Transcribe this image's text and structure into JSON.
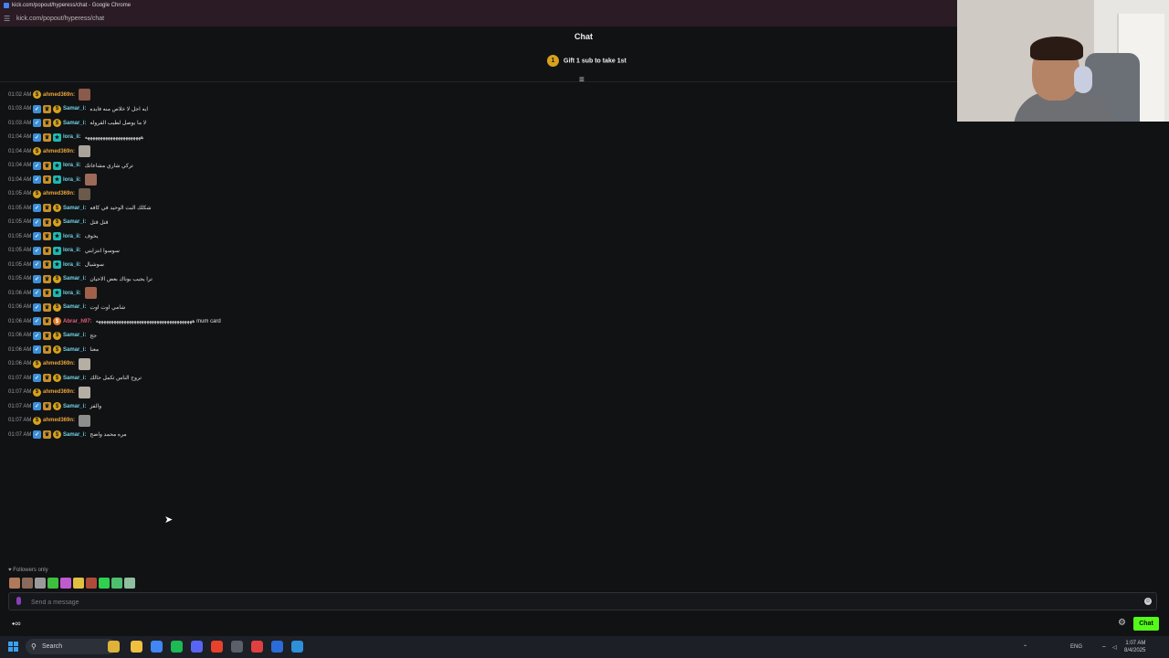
{
  "browser": {
    "title": "kick.com/popout/hyperess/chat - Google Chrome",
    "url": "kick.com/popout/hyperess/chat"
  },
  "chat": {
    "title": "Chat",
    "gift_badge": "1",
    "gift_text": "Gift 1 sub to take 1st",
    "messages": [
      {
        "time": "01:02 AM",
        "user": "ahmed369n:",
        "color": "#e8a33a",
        "badges": [
          "sub"
        ],
        "text": "",
        "emote": "#8a5a4a"
      },
      {
        "time": "01:03 AM",
        "user": "Samar_i:",
        "color": "#6fd3e6",
        "badges": [
          "blue",
          "crown",
          "sub"
        ],
        "text": "ايه اجل لا خلاص منه فايده",
        "emote": ""
      },
      {
        "time": "01:03 AM",
        "user": "Samar_i:",
        "color": "#6fd3e6",
        "badges": [
          "blue",
          "crown",
          "sub"
        ],
        "text": "لا ما يوصل لطيب القروله",
        "emote": ""
      },
      {
        "time": "01:04 AM",
        "user": "lora_ii:",
        "color": "#6fd3e6",
        "badges": [
          "blue",
          "crown",
          "teal"
        ],
        "text": "ههههههههههههههههههههههه",
        "emote": ""
      },
      {
        "time": "01:04 AM",
        "user": "ahmed369n:",
        "color": "#e8a33a",
        "badges": [
          "sub"
        ],
        "text": "",
        "emote": "#a9a39a"
      },
      {
        "time": "01:04 AM",
        "user": "lora_ii:",
        "color": "#6fd3e6",
        "badges": [
          "blue",
          "crown",
          "teal"
        ],
        "text": "تركي شاري مشاعاتك",
        "emote": ""
      },
      {
        "time": "01:04 AM",
        "user": "lora_ii:",
        "color": "#6fd3e6",
        "badges": [
          "blue",
          "crown",
          "teal"
        ],
        "text": "",
        "emote": "#9c6a58"
      },
      {
        "time": "01:05 AM",
        "user": "ahmed369n:",
        "color": "#e8a33a",
        "badges": [
          "sub"
        ],
        "text": "",
        "emote": "#6b5a4a"
      },
      {
        "time": "01:05 AM",
        "user": "Samar_i:",
        "color": "#6fd3e6",
        "badges": [
          "blue",
          "crown",
          "sub"
        ],
        "text": "شكلك البث الوحيد في كافه",
        "emote": ""
      },
      {
        "time": "01:05 AM",
        "user": "Samar_i:",
        "color": "#6fd3e6",
        "badges": [
          "blue",
          "crown",
          "sub"
        ],
        "text": "قتل قتل",
        "emote": ""
      },
      {
        "time": "01:05 AM",
        "user": "lora_ii:",
        "color": "#6fd3e6",
        "badges": [
          "blue",
          "crown",
          "teal"
        ],
        "text": "يخوف",
        "emote": ""
      },
      {
        "time": "01:05 AM",
        "user": "lora_ii:",
        "color": "#6fd3e6",
        "badges": [
          "blue",
          "crown",
          "teal"
        ],
        "text": "سوسوا انتزابتي",
        "emote": ""
      },
      {
        "time": "01:05 AM",
        "user": "lora_ii:",
        "color": "#6fd3e6",
        "badges": [
          "blue",
          "crown",
          "teal"
        ],
        "text": "سوشيال",
        "emote": ""
      },
      {
        "time": "01:05 AM",
        "user": "Samar_i:",
        "color": "#6fd3e6",
        "badges": [
          "blue",
          "crown",
          "sub"
        ],
        "text": "ترا يجيب بوناك بعض الاحيان",
        "emote": ""
      },
      {
        "time": "01:06 AM",
        "user": "lora_ii:",
        "color": "#6fd3e6",
        "badges": [
          "blue",
          "crown",
          "teal"
        ],
        "text": "",
        "emote": "#a0604a"
      },
      {
        "time": "01:06 AM",
        "user": "Samar_i:",
        "color": "#6fd3e6",
        "badges": [
          "blue",
          "crown",
          "sub"
        ],
        "text": "شامي اوت اوت",
        "emote": ""
      },
      {
        "time": "01:06 AM",
        "user": "Abrar_h97:",
        "color": "#e0607a",
        "badges": [
          "blue",
          "crown",
          "orange"
        ],
        "text": "ههههههههههههههههههههههههههههههههههههههه mum card",
        "emote": ""
      },
      {
        "time": "01:06 AM",
        "user": "Samar_i:",
        "color": "#6fd3e6",
        "badges": [
          "blue",
          "crown",
          "sub"
        ],
        "text": "جج",
        "emote": ""
      },
      {
        "time": "01:06 AM",
        "user": "Samar_i:",
        "color": "#6fd3e6",
        "badges": [
          "blue",
          "crown",
          "sub"
        ],
        "text": "معنا",
        "emote": ""
      },
      {
        "time": "01:06 AM",
        "user": "ahmed369n:",
        "color": "#e8a33a",
        "badges": [
          "sub"
        ],
        "text": "",
        "emote": "#b5aea3"
      },
      {
        "time": "01:07 AM",
        "user": "Samar_i:",
        "color": "#6fd3e6",
        "badges": [
          "blue",
          "crown",
          "sub"
        ],
        "text": "تروح الناس تكمل حالك",
        "emote": ""
      },
      {
        "time": "01:07 AM",
        "user": "ahmed369n:",
        "color": "#e8a33a",
        "badges": [
          "sub"
        ],
        "text": "",
        "emote": "#b5aea3"
      },
      {
        "time": "01:07 AM",
        "user": "Samar_i:",
        "color": "#6fd3e6",
        "badges": [
          "blue",
          "crown",
          "sub"
        ],
        "text": "والفز",
        "emote": ""
      },
      {
        "time": "01:07 AM",
        "user": "ahmed369n:",
        "color": "#e8a33a",
        "badges": [
          "sub"
        ],
        "text": "",
        "emote": "#8d8d8d"
      },
      {
        "time": "01:07 AM",
        "user": "Samar_i:",
        "color": "#6fd3e6",
        "badges": [
          "blue",
          "crown",
          "sub"
        ],
        "text": "مره محمد واضح",
        "emote": ""
      }
    ],
    "followers_only": "Followers only",
    "quick_emotes": [
      "#b07a5a",
      "#8a6a5a",
      "#9a9a9a",
      "#3fbf3f",
      "#c05ad0",
      "#e0c040",
      "#b04a3a",
      "#2fcf4f",
      "#4fbf6f",
      "#8fbf9f"
    ],
    "input_placeholder": "Send a message",
    "chat_button": "Chat",
    "bottom_left_text": "∞"
  },
  "taskbar": {
    "search_label": "Search",
    "lang": "ENG",
    "time": "1:07 AM",
    "date": "8/4/2025",
    "icons": [
      "#e0b23a",
      "#f0c040",
      "#4285f4",
      "#1db954",
      "#5865f2",
      "#e8412c",
      "#5a5f6a",
      "#e04040",
      "#2b6cd8",
      "#2f8fd8"
    ]
  },
  "colors": {
    "accent": "#53fc18",
    "background": "#111214"
  }
}
